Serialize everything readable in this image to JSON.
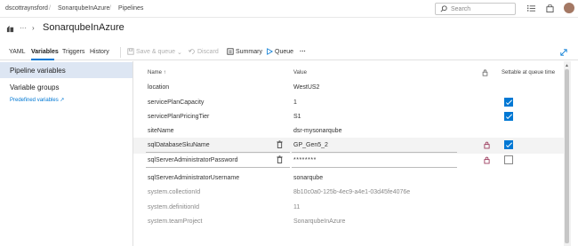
{
  "breadcrumb": {
    "org": "dscottraynsford",
    "project": "SonarqubeInAzure",
    "section": "Pipelines"
  },
  "search": {
    "placeholder": "Search"
  },
  "pipeline": {
    "title": "SonarqubeInAzure"
  },
  "tabs": [
    {
      "label": "YAML"
    },
    {
      "label": "Variables"
    },
    {
      "label": "Triggers"
    },
    {
      "label": "History"
    }
  ],
  "toolbar": {
    "save_queue": "Save & queue",
    "discard": "Discard",
    "summary": "Summary",
    "queue": "Queue",
    "more": "···"
  },
  "leftnav": {
    "pipeline_variables": "Pipeline variables",
    "variable_groups": "Variable groups",
    "predefined_variables": "Predefined variables"
  },
  "table": {
    "col_name": "Name ↑",
    "col_value": "Value",
    "col_settable": "Settable at queue time",
    "rows": [
      {
        "name": "location",
        "value": "WestUS2",
        "settable": false,
        "system": false
      },
      {
        "name": "servicePlanCapacity",
        "value": "1",
        "settable": true,
        "system": false
      },
      {
        "name": "servicePlanPricingTier",
        "value": "S1",
        "settable": true,
        "system": false
      },
      {
        "name": "siteName",
        "value": "dsr-mysonarqube",
        "settable": false,
        "system": false
      },
      {
        "name": "sqlDatabaseSkuName",
        "value": "GP_Gen5_2",
        "settable": true,
        "system": false
      },
      {
        "name": "sqlServerAdministratorPassword",
        "value": "********",
        "settable": false,
        "system": false
      },
      {
        "name": "sqlServerAdministratorUsername",
        "value": "sonarqube",
        "settable": false,
        "system": false
      },
      {
        "name": "system.collectionId",
        "value": "8b10c0a0-125b-4ec9-a4e1-03d45fe4076e",
        "settable": false,
        "system": true
      },
      {
        "name": "system.definitionId",
        "value": "11",
        "settable": false,
        "system": true
      },
      {
        "name": "system.teamProject",
        "value": "SonarqubeInAzure",
        "settable": false,
        "system": true
      }
    ]
  },
  "colors": {
    "accent": "#0078d4",
    "selected_nav": "#dde6f3"
  }
}
